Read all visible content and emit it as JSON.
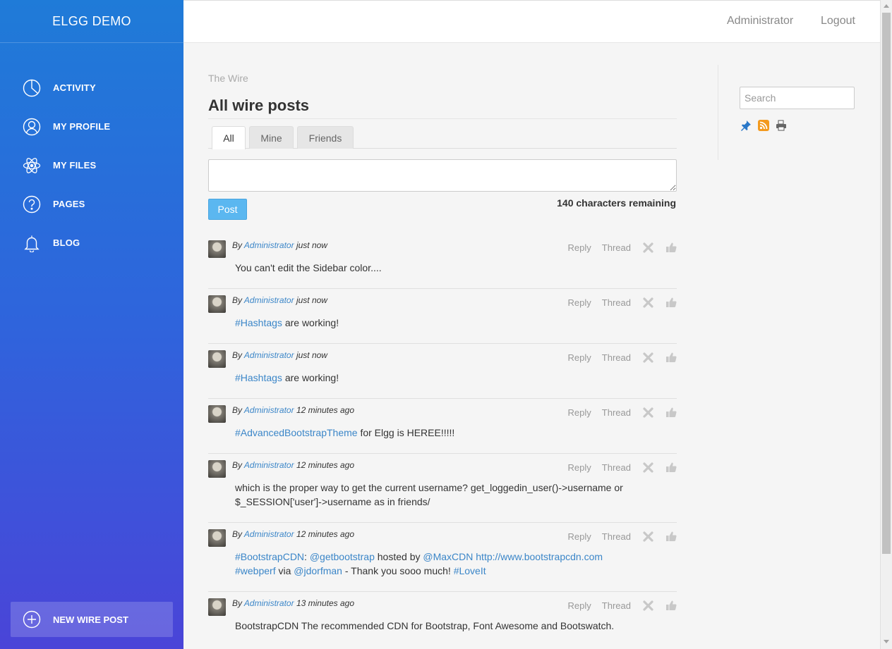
{
  "brand": "ELGG DEMO",
  "nav": [
    {
      "label": "ACTIVITY",
      "icon": "pie-chart-icon"
    },
    {
      "label": "MY PROFILE",
      "icon": "user-icon"
    },
    {
      "label": "MY FILES",
      "icon": "atom-icon"
    },
    {
      "label": "PAGES",
      "icon": "question-icon"
    },
    {
      "label": "BLOG",
      "icon": "bell-icon"
    }
  ],
  "new_post": {
    "label": "NEW WIRE POST",
    "icon": "plus-circle-icon"
  },
  "topbar": {
    "user": "Administrator",
    "logout": "Logout"
  },
  "breadcrumb": "The Wire",
  "title": "All wire posts",
  "tabs": [
    "All",
    "Mine",
    "Friends"
  ],
  "composer": {
    "value": "",
    "post_label": "Post",
    "remaining": "140 characters remaining"
  },
  "post_common": {
    "by": "By",
    "author": "Administrator",
    "reply": "Reply",
    "thread": "Thread"
  },
  "posts": [
    {
      "time": "just now",
      "segments": [
        {
          "t": "You can't edit the Sidebar color....",
          "tag": false
        }
      ]
    },
    {
      "time": "just now",
      "segments": [
        {
          "t": "#Hashtags",
          "tag": true
        },
        {
          "t": " are working!",
          "tag": false
        }
      ]
    },
    {
      "time": "just now",
      "segments": [
        {
          "t": "#Hashtags",
          "tag": true
        },
        {
          "t": " are working!",
          "tag": false
        }
      ]
    },
    {
      "time": "12 minutes ago",
      "segments": [
        {
          "t": "#AdvancedBootstrapTheme",
          "tag": true
        },
        {
          "t": " for Elgg is HEREE!!!!!",
          "tag": false
        }
      ]
    },
    {
      "time": "12 minutes ago",
      "segments": [
        {
          "t": "which is the proper way to get the current username? get_loggedin_user()->username or $_SESSION['user']->username as in friends/",
          "tag": false
        }
      ]
    },
    {
      "time": "12 minutes ago",
      "segments": [
        {
          "t": "#BootstrapCDN",
          "tag": true
        },
        {
          "t": ": ",
          "tag": false
        },
        {
          "t": "@getbootstrap",
          "tag": true
        },
        {
          "t": " hosted by ",
          "tag": false
        },
        {
          "t": "@MaxCDN",
          "tag": true
        },
        {
          "t": " ",
          "tag": false
        },
        {
          "t": "http://www.bootstrapcdn.com",
          "tag": true
        },
        {
          "t": " ",
          "tag": false
        },
        {
          "t": "#webperf",
          "tag": true
        },
        {
          "t": " via ",
          "tag": false
        },
        {
          "t": "@jdorfman",
          "tag": true
        },
        {
          "t": " - Thank you sooo much! ",
          "tag": false
        },
        {
          "t": "#LoveIt",
          "tag": true
        }
      ]
    },
    {
      "time": "13 minutes ago",
      "segments": [
        {
          "t": "BootstrapCDN The recommended CDN for Bootstrap, Font Awesome and Bootswatch.",
          "tag": false
        }
      ]
    }
  ],
  "search": {
    "placeholder": "Search",
    "value": ""
  },
  "right_icons": [
    "pin-icon",
    "rss-icon",
    "print-icon"
  ],
  "colors": {
    "accent": "#3b86c8",
    "sidebar_top": "#1f7bd8",
    "sidebar_bottom": "#4a44d8",
    "post_button": "#5bb7f0"
  }
}
